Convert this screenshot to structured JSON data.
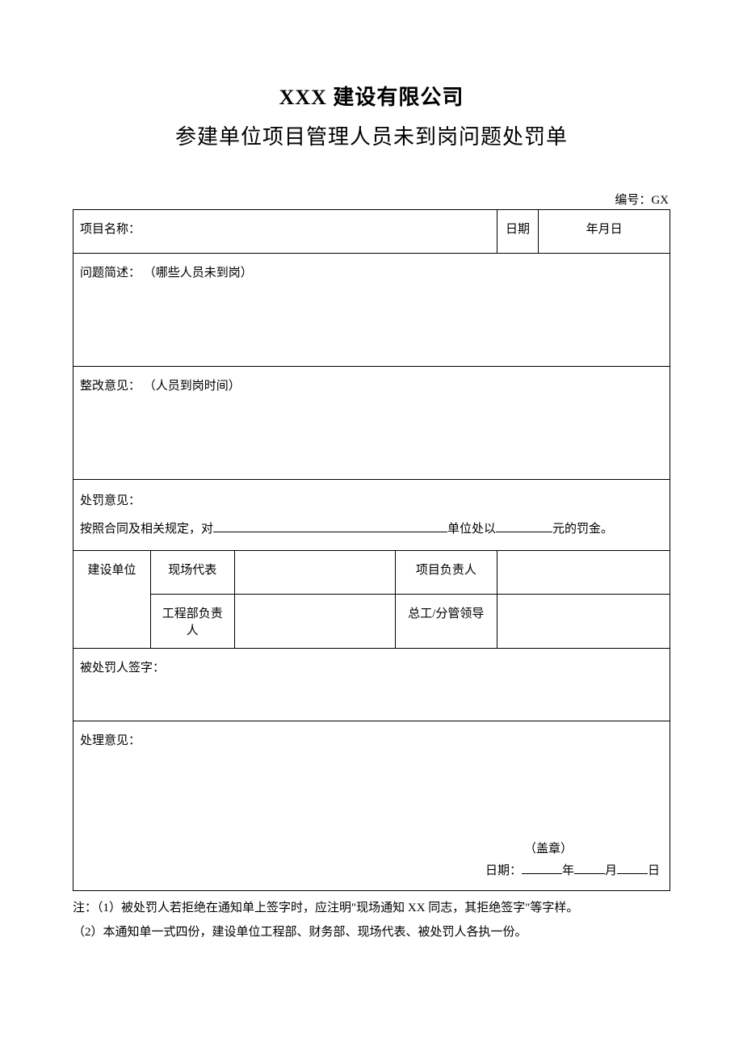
{
  "header": {
    "company": "XXX 建设有限公司",
    "form_title": "参建单位项目管理人员未到岗问题处罚单",
    "doc_number_label": "编号：GX"
  },
  "row1": {
    "project_label": "项目名称：",
    "date_label": "日期",
    "date_value": "年月日"
  },
  "problem": {
    "label": "问题简述：",
    "hint": "（哪些人员未到岗）"
  },
  "rectify": {
    "label": "整改意见：",
    "hint": "（人员到岗时间）"
  },
  "penalty": {
    "label": "处罚意见：",
    "line_prefix": "按照合同及相关规定，对",
    "line_mid": "单位处以",
    "line_suffix": "元的罚金。"
  },
  "sig": {
    "builder_unit": "建设单位",
    "site_rep": "现场代表",
    "eng_dept_lead": "工程部负责人",
    "proj_lead": "项目负责人",
    "chief_lead": "总工/分管领导"
  },
  "punished_sign": {
    "label": "被处罚人签字："
  },
  "handling": {
    "label": "处理意见：",
    "seal": "（盖章）",
    "date_prefix": "日期：",
    "year": "年",
    "month": "月",
    "day": "日"
  },
  "notes": {
    "n1": "注：（1）被处罚人若拒绝在通知单上签字时，应注明\"现场通知 XX 同志，其拒绝签字\"等字样。",
    "n2": "（2）本通知单一式四份，建设单位工程部、财务部、现场代表、被处罚人各执一份。"
  }
}
